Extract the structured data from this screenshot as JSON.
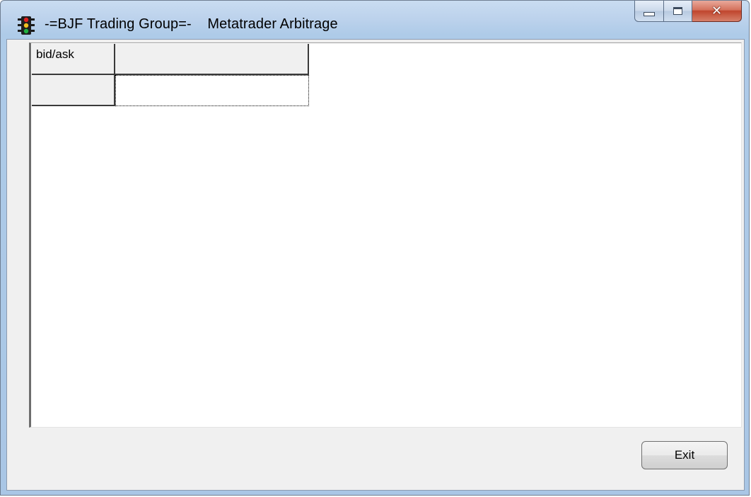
{
  "window": {
    "title_left": "-=BJF Trading Group=-",
    "title_right": "Metatrader Arbitrage",
    "app_icon": "traffic-light-icon",
    "caption_buttons": {
      "minimize": "minimize-icon",
      "maximize": "maximize-icon",
      "close": "close-icon"
    }
  },
  "grid": {
    "header_row": [
      "bid/ask",
      ""
    ],
    "rows": [
      [
        "",
        ""
      ]
    ]
  },
  "buttons": {
    "exit_label": "Exit"
  },
  "colors": {
    "titlebar": "#bcd2ec",
    "client_background": "#f0f0f0",
    "close_button": "#c0452d"
  }
}
